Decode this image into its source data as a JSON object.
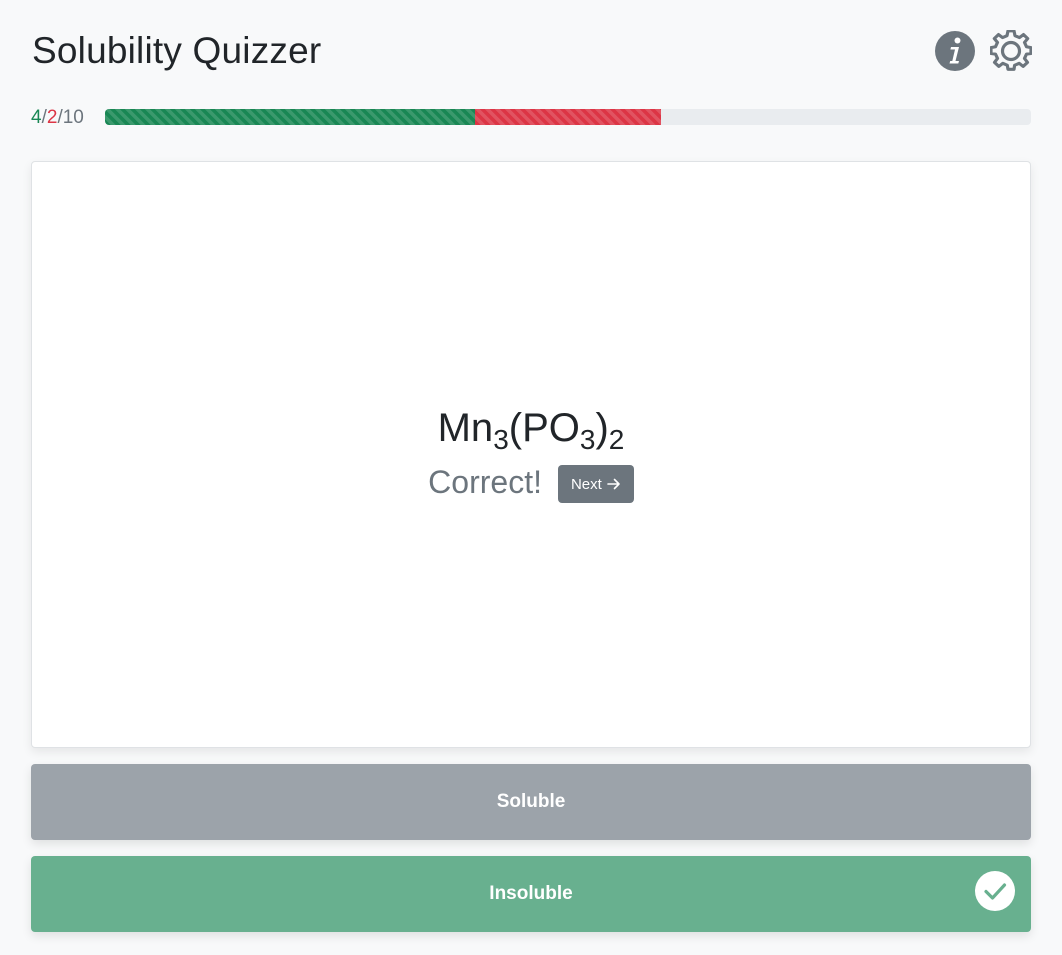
{
  "app": {
    "title": "Solubility Quizzer"
  },
  "header": {
    "info_icon": "info-circle-icon",
    "settings_icon": "gear-icon"
  },
  "score": {
    "correct": "4",
    "wrong": "2",
    "total": "10",
    "sep1": "/",
    "sep2": "/"
  },
  "progress": {
    "correct_fraction": 0.4,
    "wrong_fraction": 0.2
  },
  "question": {
    "formula_parts": [
      {
        "text": "Mn",
        "sub": false
      },
      {
        "text": "3",
        "sub": true
      },
      {
        "text": "(PO",
        "sub": false
      },
      {
        "text": "3",
        "sub": true
      },
      {
        "text": ")",
        "sub": false
      },
      {
        "text": "2",
        "sub": true
      }
    ],
    "feedback": "Correct!",
    "next_label": "Next",
    "next_icon": "arrow-right-icon"
  },
  "answers": [
    {
      "label": "Soluble",
      "state": "neutral"
    },
    {
      "label": "Insoluble",
      "state": "correct",
      "icon": "check-circle-icon"
    }
  ],
  "colors": {
    "correct": "#198754",
    "wrong": "#dc3545",
    "secondary": "#6c757d",
    "insoluble_bg": "#68b08f",
    "soluble_bg": "#9ca3aa"
  }
}
